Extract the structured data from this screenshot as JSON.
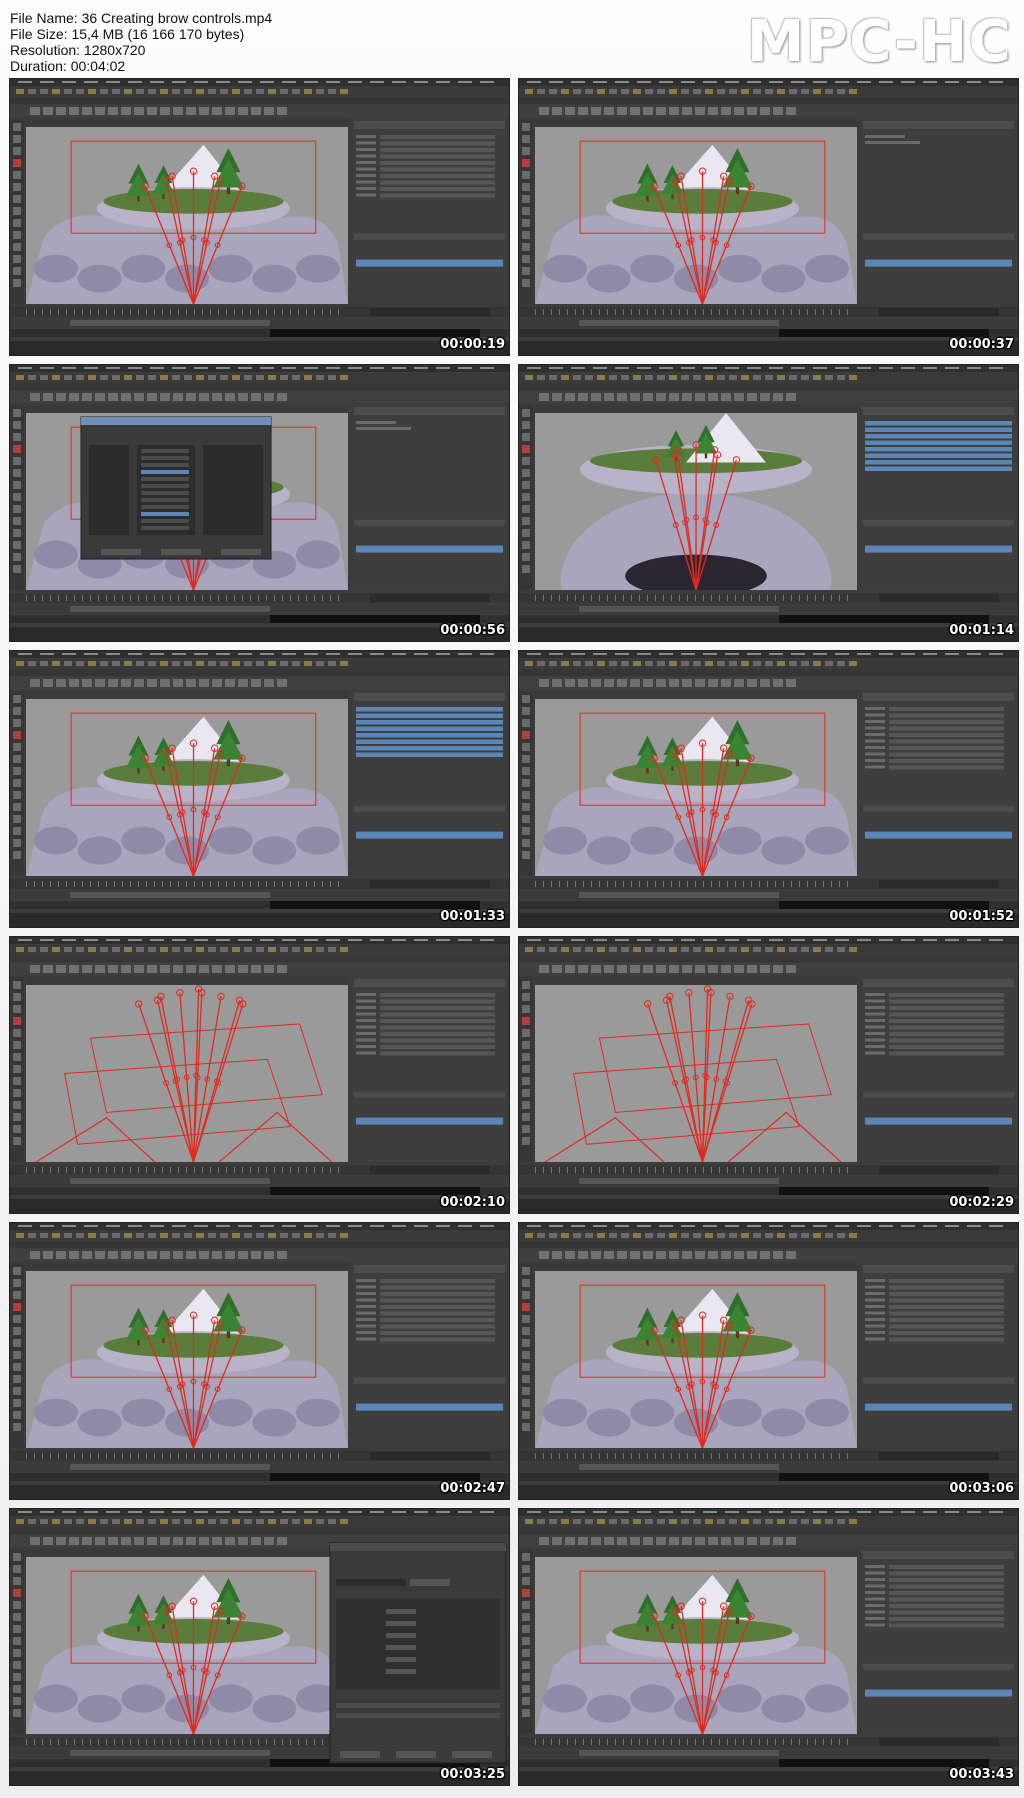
{
  "file_info": {
    "name_line": "File Name: 36 Creating brow controls.mp4",
    "size_line": "File Size: 15,4 MB (16 166 170 bytes)",
    "resolution_line": "Resolution: 1280x720",
    "duration_line": "Duration: 00:04:02"
  },
  "logo": "MPC-HC",
  "colors": {
    "ui_dark": "#3c3c3c",
    "viewport": "#9a9a9a",
    "rig_red": "#e02a1e",
    "highlight_blue": "#5b86b8",
    "rock": "#a9a5bd"
  },
  "thumbnails": [
    {
      "time": "00:00:19",
      "scene": "island",
      "panel": "list",
      "dialog": "none"
    },
    {
      "time": "00:00:37",
      "scene": "island",
      "panel": "empty",
      "dialog": "none"
    },
    {
      "time": "00:00:56",
      "scene": "island",
      "panel": "empty",
      "dialog": "connection"
    },
    {
      "time": "00:01:14",
      "scene": "closeup",
      "panel": "blue",
      "dialog": "none"
    },
    {
      "time": "00:01:33",
      "scene": "island",
      "panel": "blue",
      "dialog": "none"
    },
    {
      "time": "00:01:52",
      "scene": "island",
      "panel": "list",
      "dialog": "none"
    },
    {
      "time": "00:02:10",
      "scene": "wire",
      "panel": "list",
      "dialog": "none"
    },
    {
      "time": "00:02:29",
      "scene": "wire",
      "panel": "list",
      "dialog": "none"
    },
    {
      "time": "00:02:47",
      "scene": "island",
      "panel": "list",
      "dialog": "none"
    },
    {
      "time": "00:03:06",
      "scene": "island",
      "panel": "list",
      "dialog": "none"
    },
    {
      "time": "00:03:25",
      "scene": "island",
      "panel": "empty",
      "dialog": "editor"
    },
    {
      "time": "00:03:43",
      "scene": "island",
      "panel": "list",
      "dialog": "none"
    }
  ]
}
